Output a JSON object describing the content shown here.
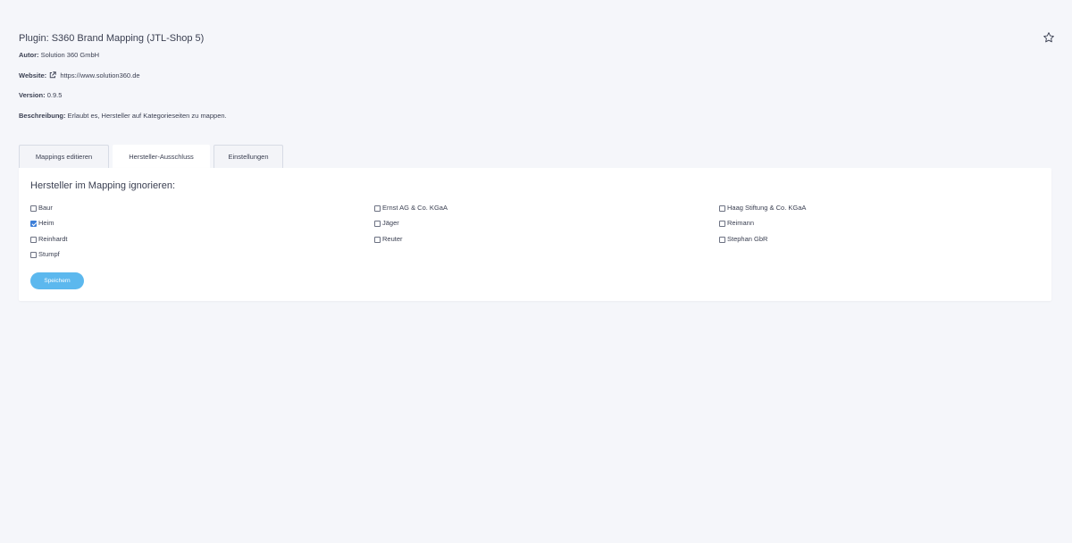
{
  "plugin": {
    "title": "Plugin: S360 Brand Mapping (JTL-Shop 5)",
    "author_label": "Autor:",
    "author_value": "Solution 360 GmbH",
    "website_label": "Website:",
    "website_value": "https://www.solution360.de",
    "version_label": "Version:",
    "version_value": "0.9.5",
    "description_label": "Beschreibung:",
    "description_value": "Erlaubt es, Hersteller auf Kategorieseiten zu mappen."
  },
  "icons": {
    "favorite": "star-outline-icon",
    "external_link": "external-link-icon"
  },
  "tabs": [
    {
      "label": "Mappings editieren",
      "active": false
    },
    {
      "label": "Hersteller-Ausschluss",
      "active": true
    },
    {
      "label": "Einstellungen",
      "active": false
    }
  ],
  "panel": {
    "heading": "Hersteller im Mapping ignorieren:",
    "manufacturers": [
      {
        "label": "Baur",
        "checked": false
      },
      {
        "label": "Ernst AG & Co. KGaA",
        "checked": false
      },
      {
        "label": "Haag Stiftung & Co. KGaA",
        "checked": false
      },
      {
        "label": "Heim",
        "checked": true
      },
      {
        "label": "Jäger",
        "checked": false
      },
      {
        "label": "Reimann",
        "checked": false
      },
      {
        "label": "Reinhardt",
        "checked": false
      },
      {
        "label": "Reuter",
        "checked": false
      },
      {
        "label": "Stephan GbR",
        "checked": false
      },
      {
        "label": "Stumpf",
        "checked": false
      }
    ],
    "save_label": "Speichern"
  },
  "colors": {
    "background": "#f5f6fa",
    "primary_button": "#5cb8ee",
    "checkbox_checked": "#3d7fd8",
    "text": "#3a3f51"
  }
}
